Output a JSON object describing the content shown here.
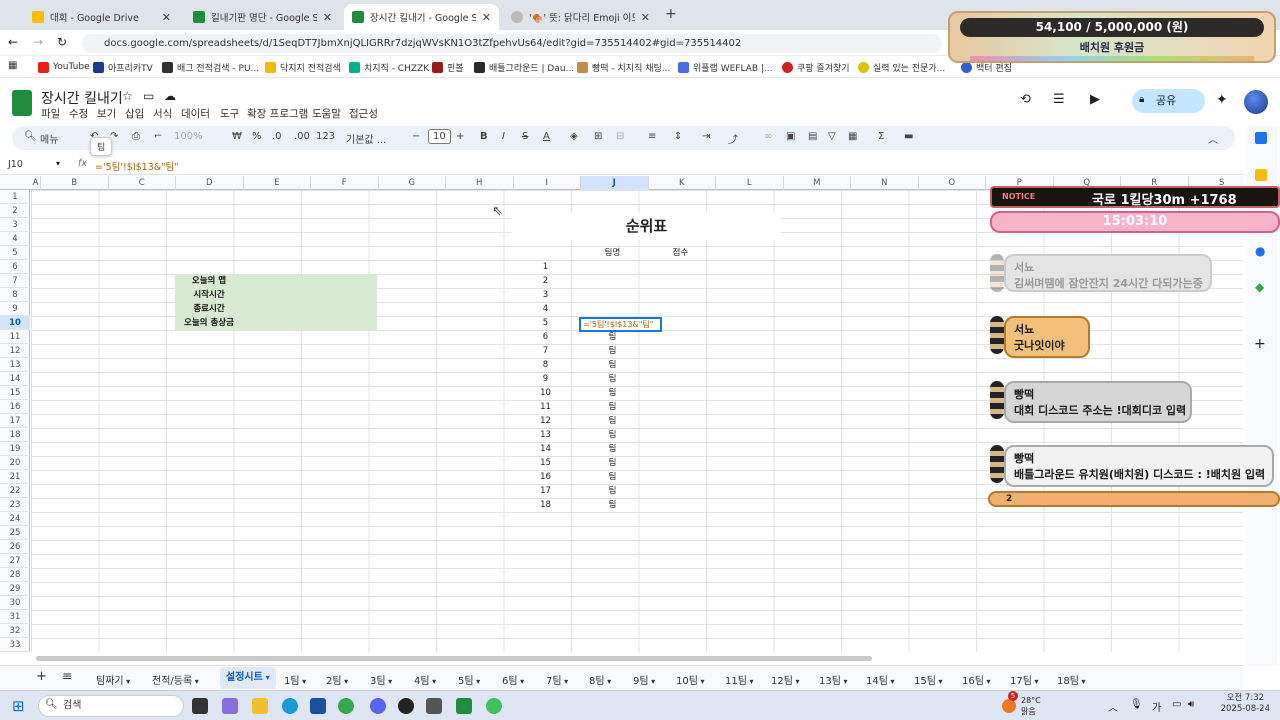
{
  "browser": {
    "tabs": [
      {
        "label": "대회 - Google Drive",
        "color": "#1a73e8"
      },
      {
        "label": "킬내기판 명단 - Google Sheets",
        "color": "#1e8e3e"
      },
      {
        "label": "장시간 킬내기 - Google Sheets",
        "color": "#1e8e3e"
      },
      {
        "label": "'🍖' 뜻: 닭다리 Emoji 이모티콘",
        "color": "#777777"
      }
    ],
    "url": "docs.google.com/spreadsheets/d/1SeqDT7JbmXnjQLIGRRr7dzjqWVsKN1O3tZfpehvUs64/edit?gid=735514402#gid=735514402",
    "bookmarks": [
      "YouTube",
      "아프리카TV",
      "배그 전적검색 - PU...",
      "닥지지 전적검색",
      "치지직 - CHZZK",
      "핀볼",
      "배틀그라운드 | Dau...",
      "빵떡 - 치지직 채팅...",
      "위플랩 WEFLAB |...",
      "쿠팡 즐겨찾기",
      "실력 있는 전문가...",
      "백터 편집"
    ]
  },
  "banner": {
    "progress": "54,100 / 5,000,000 (원)",
    "subtitle": "배치원 후원금"
  },
  "sheets": {
    "title": "장시간 킬내기",
    "menus": [
      "파일",
      "수정",
      "보기",
      "삽입",
      "서식",
      "데이터",
      "도구",
      "확장 프로그램",
      "도움말",
      "접근성"
    ],
    "share": "공유",
    "toolbar": {
      "menu_search": "메뉴",
      "zoom": "100%",
      "currency": "₩",
      "percent": "%",
      "dec_less": ".0",
      "dec_more": ".00",
      "numfmt": "123",
      "font": "기본값 ...",
      "fontsize": "10",
      "minus": "−",
      "plus": "+",
      "bold": "B",
      "italic": "I",
      "strike": "S",
      "textcolor": "A",
      "sum": "Σ"
    },
    "namebox": "J10",
    "fx": "fx",
    "formula": "='5팀'!$I$13&\"팀\"",
    "tooltip": "팀"
  },
  "columns": [
    "A",
    "B",
    "C",
    "D",
    "E",
    "F",
    "G",
    "H",
    "I",
    "J",
    "K",
    "L",
    "M",
    "N",
    "O",
    "P",
    "Q",
    "R",
    "S"
  ],
  "rows": [
    "1",
    "2",
    "3",
    "4",
    "5",
    "6",
    "7",
    "8",
    "9",
    "10",
    "11",
    "12",
    "13",
    "14",
    "15",
    "16",
    "17",
    "18",
    "19",
    "20",
    "21",
    "22",
    "23",
    "24",
    "25",
    "26",
    "27",
    "28",
    "29",
    "30",
    "31",
    "32",
    "33"
  ],
  "cells": {
    "labels": [
      "오늘의 맵",
      "시작시간",
      "종료시간",
      "오늘의 총상금"
    ],
    "rank_title": "순위표",
    "team_header": "팀명",
    "score_header": "점수",
    "ranks": [
      "1",
      "2",
      "3",
      "4",
      "5",
      "6",
      "7",
      "8",
      "9",
      "10",
      "11",
      "12",
      "13",
      "14",
      "15",
      "16",
      "17",
      "18"
    ],
    "team_values": [
      "팀",
      "팀",
      "팀",
      "팀",
      "팀",
      "팀",
      "팀",
      "팀",
      "팀",
      "팀",
      "팀",
      "팀",
      "팀"
    ]
  },
  "sheet_tabs": [
    "팀짜기",
    "전적/등록",
    "설정시트",
    "1팀",
    "2팀",
    "3팀",
    "4팀",
    "5팀",
    "6팀",
    "7팀",
    "8팀",
    "9팀",
    "10팀",
    "11팀",
    "12팀",
    "13팀",
    "14팀",
    "15팀",
    "16팀",
    "17팀",
    "18팀"
  ],
  "overlay": {
    "notice_label": "NOTICE",
    "notice": "국로 1킬당30m +1768",
    "clock": "15:03:10",
    "chats": [
      {
        "name": "서뇨",
        "text": "김써며땜에 잠안잔지 24시간 다되가는중"
      },
      {
        "name": "서뇨",
        "text": "굿나잇이야"
      },
      {
        "name": "빵떡",
        "text": "대회 디스코드 주소는 !대회디코 입력"
      },
      {
        "name": "빵떡",
        "text": "배틀그라운드 유치원(배치원) 디스코드 : !배치원 입력"
      }
    ],
    "viewers": "2"
  },
  "taskbar": {
    "search": "검색",
    "weather_temp": "28°C",
    "weather_desc": "맑음",
    "ime": "가",
    "time": "오전 7:32",
    "date": "2025-08-24",
    "badge": "5"
  }
}
